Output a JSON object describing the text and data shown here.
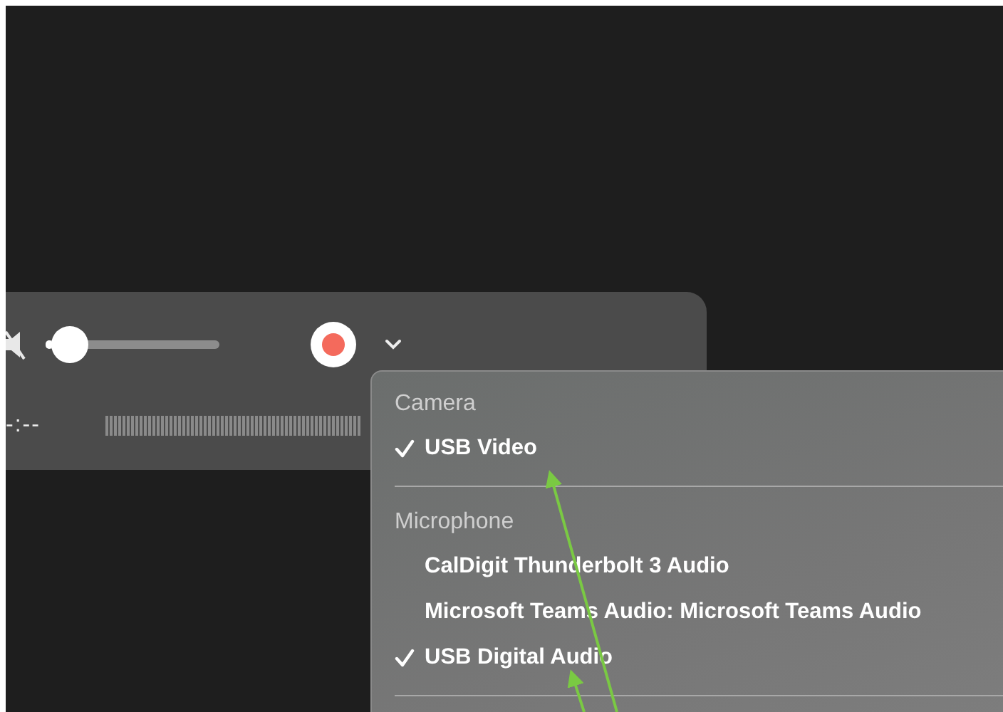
{
  "player": {
    "volume_slider": {
      "level": 0.04
    },
    "time": "-:--"
  },
  "menu": {
    "sections": [
      {
        "title": "Camera",
        "items": [
          {
            "label": "USB Video",
            "selected": true
          }
        ]
      },
      {
        "title": "Microphone",
        "items": [
          {
            "label": "CalDigit Thunderbolt 3 Audio",
            "selected": false
          },
          {
            "label": "Microsoft Teams Audio: Microsoft Teams Audio",
            "selected": false
          },
          {
            "label": "USB Digital Audio",
            "selected": true
          }
        ]
      }
    ]
  }
}
